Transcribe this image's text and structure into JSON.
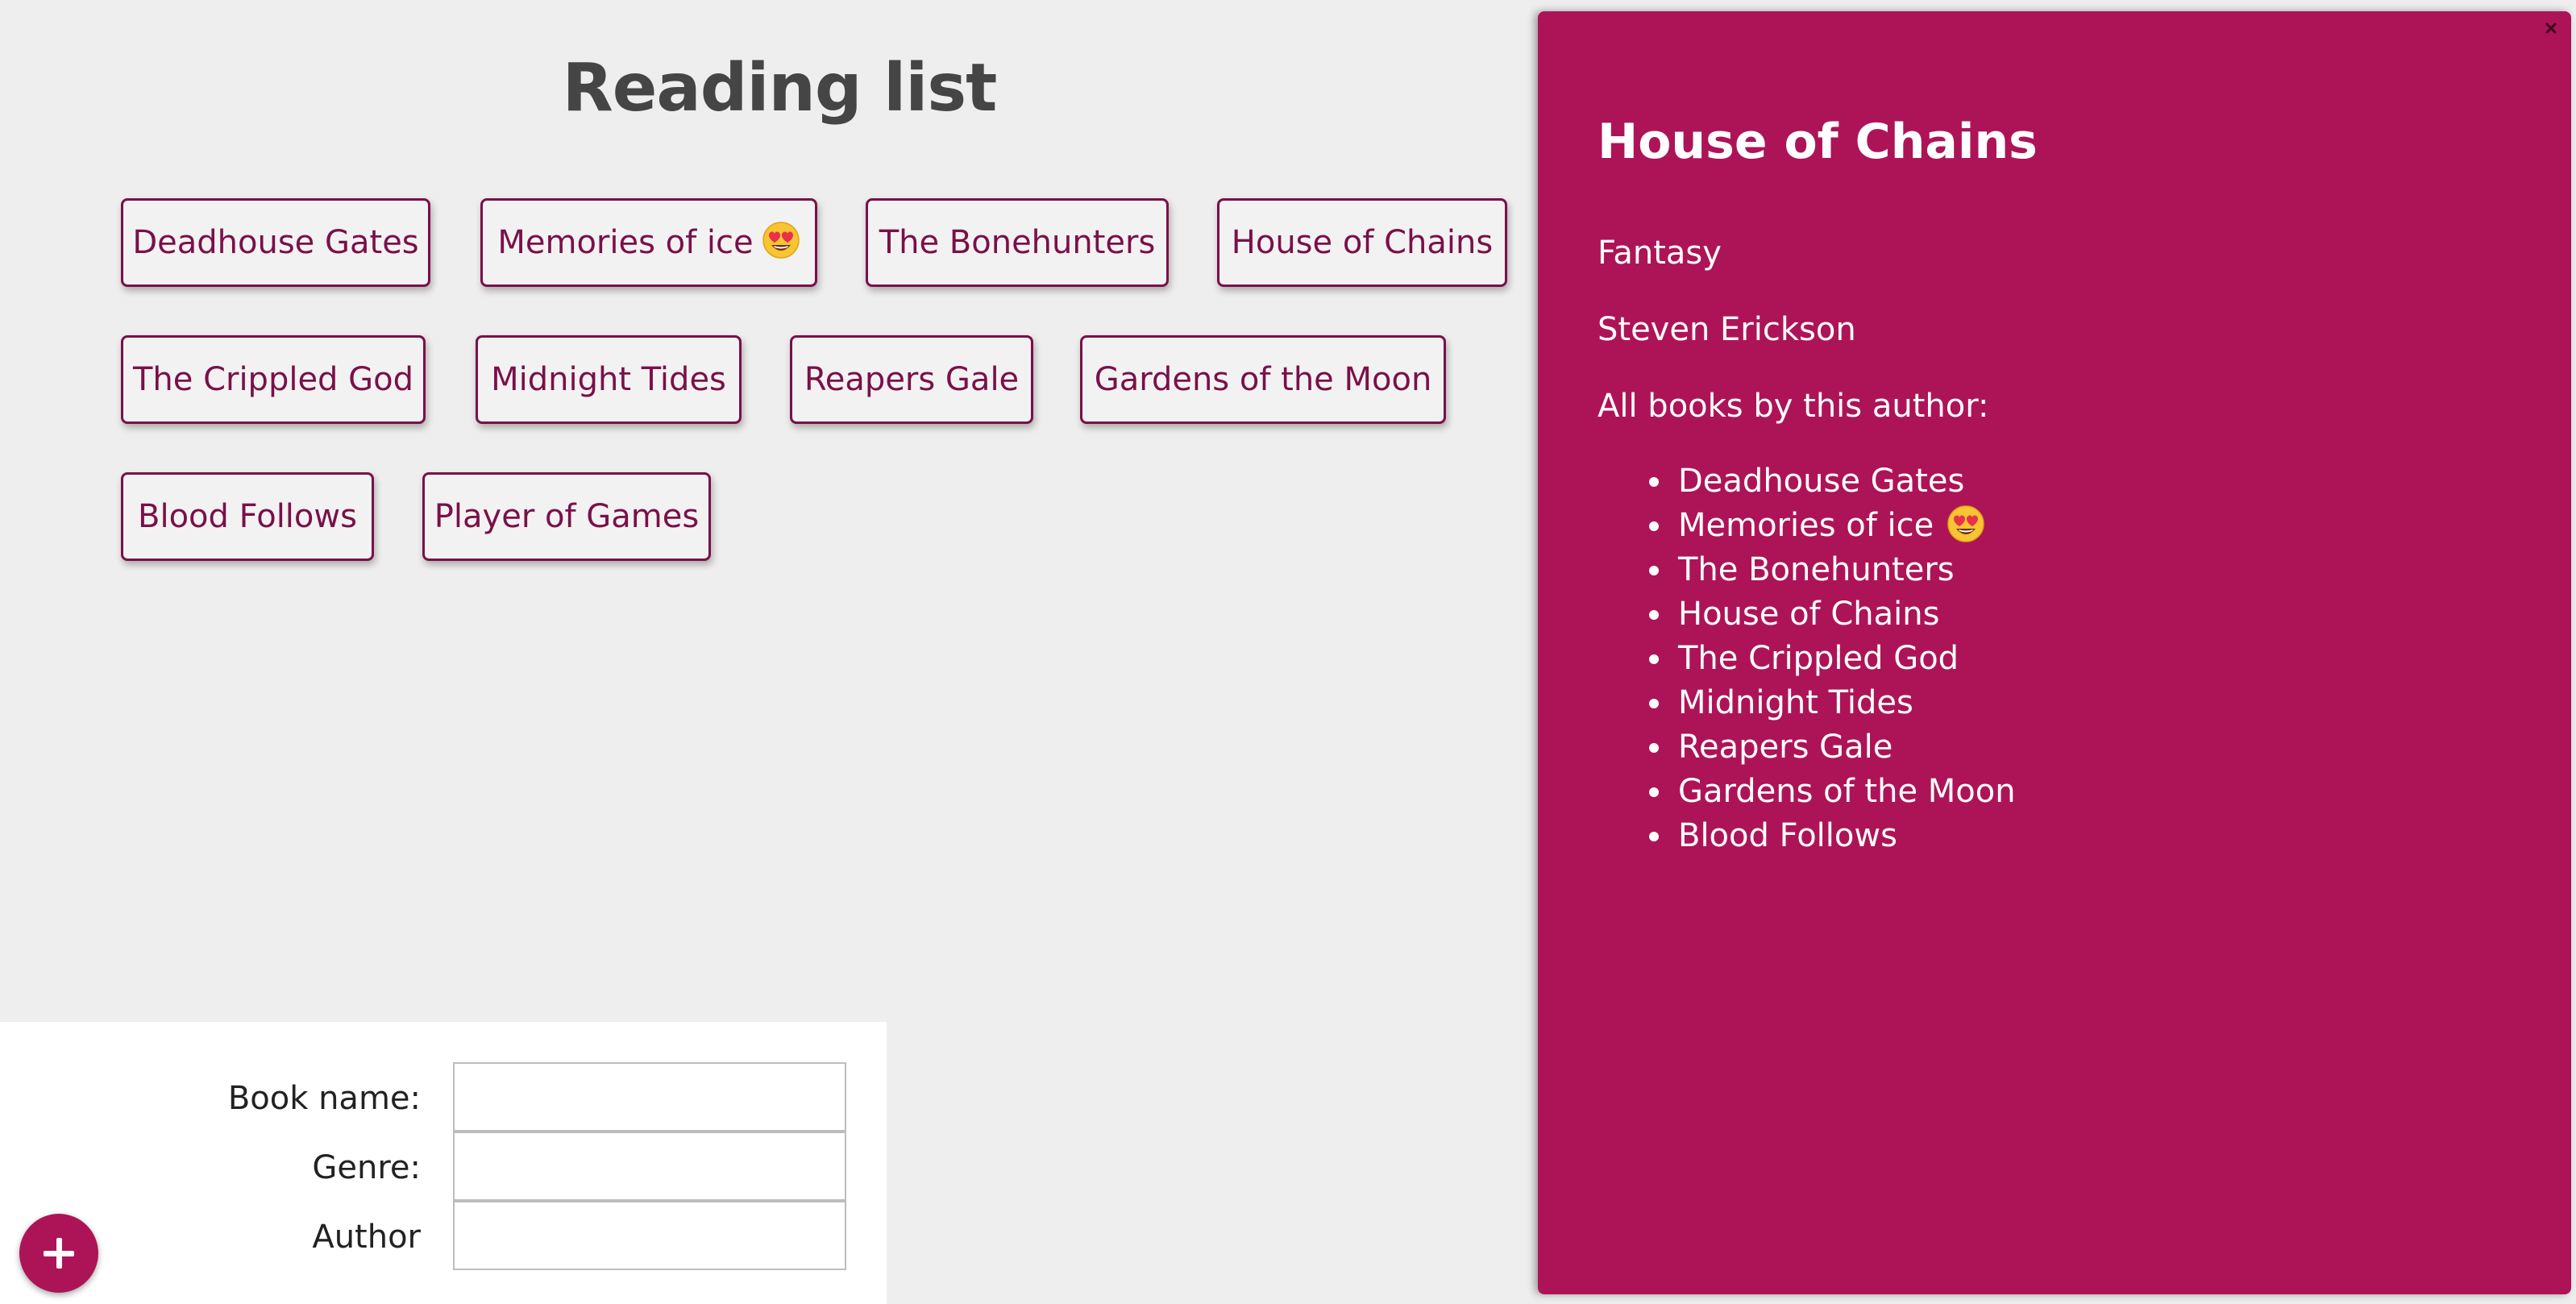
{
  "page": {
    "title": "Reading list"
  },
  "books": [
    {
      "label": "Deadhouse Gates",
      "emoji": ""
    },
    {
      "label": "Memories of ice",
      "emoji": "heart-eyes"
    },
    {
      "label": "The Bonehunters",
      "emoji": ""
    },
    {
      "label": "House of Chains",
      "emoji": ""
    },
    {
      "label": "The Crippled God",
      "emoji": ""
    },
    {
      "label": "Midnight Tides",
      "emoji": ""
    },
    {
      "label": "Reapers Gale",
      "emoji": ""
    },
    {
      "label": "Gardens of the Moon",
      "emoji": ""
    },
    {
      "label": "Blood Follows",
      "emoji": ""
    },
    {
      "label": "Player of Games",
      "emoji": ""
    }
  ],
  "form": {
    "book_name_label": "Book name:",
    "book_name_value": "",
    "genre_label": "Genre:",
    "genre_value": "",
    "author_label": "Author",
    "author_value": "",
    "add_button_icon": "plus-icon"
  },
  "detail": {
    "title": "House of Chains",
    "genre": "Fantasy",
    "author": "Steven Erickson",
    "books_heading": "All books by this author:",
    "author_books": [
      {
        "label": "Deadhouse Gates",
        "emoji": ""
      },
      {
        "label": "Memories of ice",
        "emoji": "heart-eyes"
      },
      {
        "label": "The Bonehunters",
        "emoji": ""
      },
      {
        "label": "House of Chains",
        "emoji": ""
      },
      {
        "label": "The Crippled God",
        "emoji": ""
      },
      {
        "label": "Midnight Tides",
        "emoji": ""
      },
      {
        "label": "Reapers Gale",
        "emoji": ""
      },
      {
        "label": "Gardens of the Moon",
        "emoji": ""
      },
      {
        "label": "Blood Follows",
        "emoji": ""
      }
    ],
    "close_icon": "close-icon"
  },
  "colors": {
    "background": "#eeeeee",
    "accent": "#ad1457",
    "button_text": "#7a1048",
    "title_text": "#454545"
  }
}
